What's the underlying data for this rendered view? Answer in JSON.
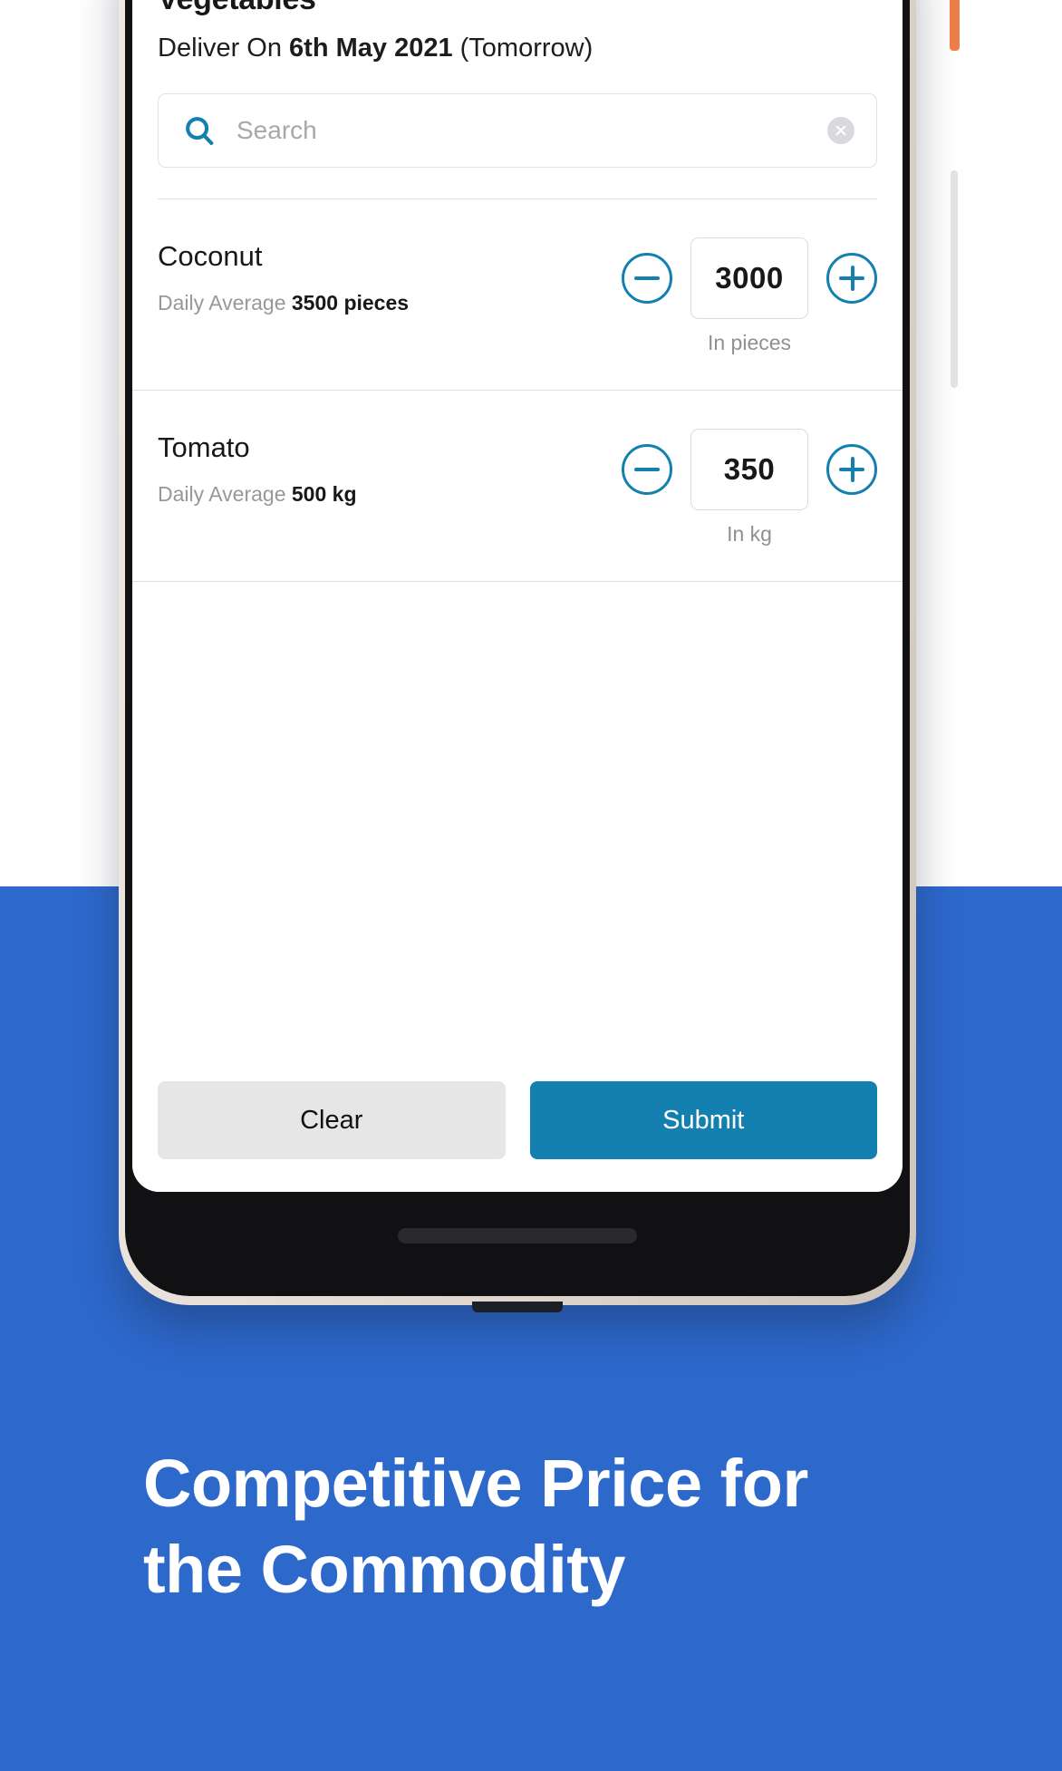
{
  "app": {
    "title": "Vegetables",
    "deliver_prefix": "Deliver On ",
    "deliver_date": "6th May 2021",
    "deliver_suffix": " (Tomorrow)",
    "search": {
      "placeholder": "Search",
      "value": "",
      "icon": "search-icon",
      "clear_icon": "clear-circle-icon"
    },
    "items": [
      {
        "name": "Coconut",
        "avg_label": "Daily Average ",
        "avg_value": "3500 pieces",
        "quantity": "3000",
        "unit_label": "In pieces",
        "decrement_icon": "minus-circle-icon",
        "increment_icon": "plus-circle-icon"
      },
      {
        "name": "Tomato",
        "avg_label": "Daily Average ",
        "avg_value": "500 kg",
        "quantity": "350",
        "unit_label": "In kg",
        "decrement_icon": "minus-circle-icon",
        "increment_icon": "plus-circle-icon"
      }
    ],
    "footer": {
      "clear_label": "Clear",
      "submit_label": "Submit"
    }
  },
  "promo": {
    "headline_line1": "Competitive Price for",
    "headline_line2": "the Commodity"
  },
  "colors": {
    "background": "#2d68cb",
    "accent": "#1380b0",
    "clear_button": "#e6e6e7",
    "text_dark": "#18181b",
    "text_muted": "#97979d"
  }
}
